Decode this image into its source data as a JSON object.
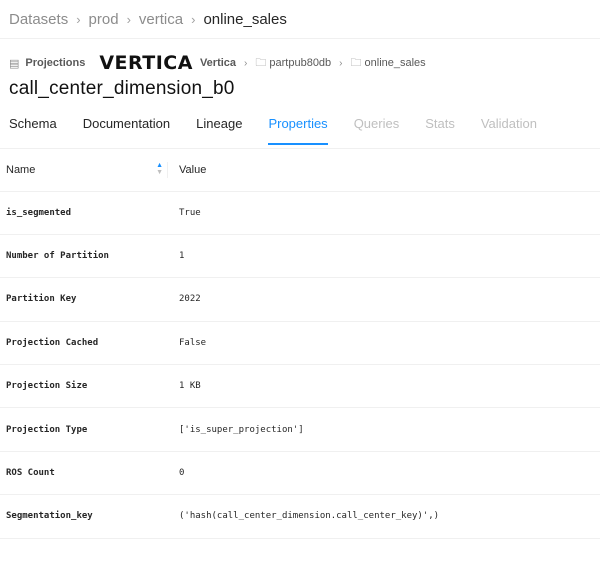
{
  "breadcrumb": {
    "items": [
      "Datasets",
      "prod",
      "vertica",
      "online_sales"
    ]
  },
  "subheader": {
    "type_label": "Projections",
    "platform_logo_text": "VERTICA",
    "platform_name": "Vertica",
    "containers": [
      "partpub80db",
      "online_sales"
    ]
  },
  "title": "call_center_dimension_b0",
  "tabs": [
    {
      "label": "Schema",
      "state": "normal"
    },
    {
      "label": "Documentation",
      "state": "normal"
    },
    {
      "label": "Lineage",
      "state": "normal"
    },
    {
      "label": "Properties",
      "state": "active"
    },
    {
      "label": "Queries",
      "state": "disabled"
    },
    {
      "label": "Stats",
      "state": "disabled"
    },
    {
      "label": "Validation",
      "state": "disabled"
    }
  ],
  "table": {
    "columns": [
      "Name",
      "Value"
    ],
    "rows": [
      {
        "name": "is_segmented",
        "value": "True"
      },
      {
        "name": "Number of Partition",
        "value": "1"
      },
      {
        "name": "Partition Key",
        "value": "2022"
      },
      {
        "name": "Projection Cached",
        "value": "False"
      },
      {
        "name": "Projection Size",
        "value": "1 KB"
      },
      {
        "name": "Projection Type",
        "value": "['is_super_projection']"
      },
      {
        "name": "ROS Count",
        "value": "0"
      },
      {
        "name": "Segmentation_key",
        "value": "('hash(call_center_dimension.call_center_key)',)"
      }
    ]
  },
  "colors": {
    "accent": "#1890ff",
    "disabled": "#bfbfbf",
    "divider": "#f0f0f0"
  }
}
